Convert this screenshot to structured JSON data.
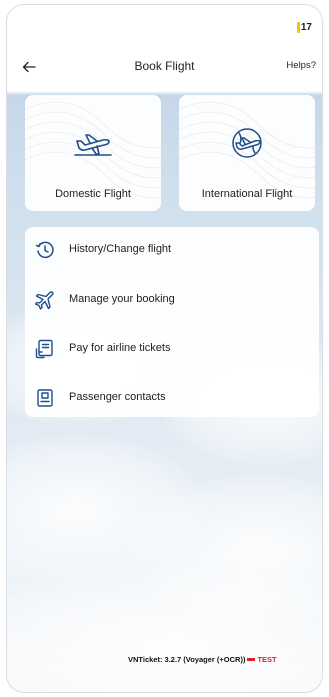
{
  "status": {
    "battery": "17",
    "battery_color": "#f4c20d"
  },
  "header": {
    "title": "Book Flight",
    "help": "Helps?"
  },
  "cards": [
    {
      "label": "Domestic Flight",
      "icon": "airplane-icon"
    },
    {
      "label": "International Flight",
      "icon": "globe-airplane-icon"
    }
  ],
  "menu": {
    "items": [
      {
        "label": "History/Change flight",
        "icon": "clock-history-icon"
      },
      {
        "label": "Manage your booking",
        "icon": "airplane-icon"
      },
      {
        "label": "Pay for airline tickets",
        "icon": "payment-icon"
      },
      {
        "label": "Passenger contacts",
        "icon": "contact-card-icon"
      }
    ]
  },
  "footer": {
    "version": "VNTicket: 3.2.7 (Voyager (+OCR))",
    "env": "TEST"
  },
  "colors": {
    "accent": "#1f4e8a",
    "test_red": "#e11d2a"
  }
}
